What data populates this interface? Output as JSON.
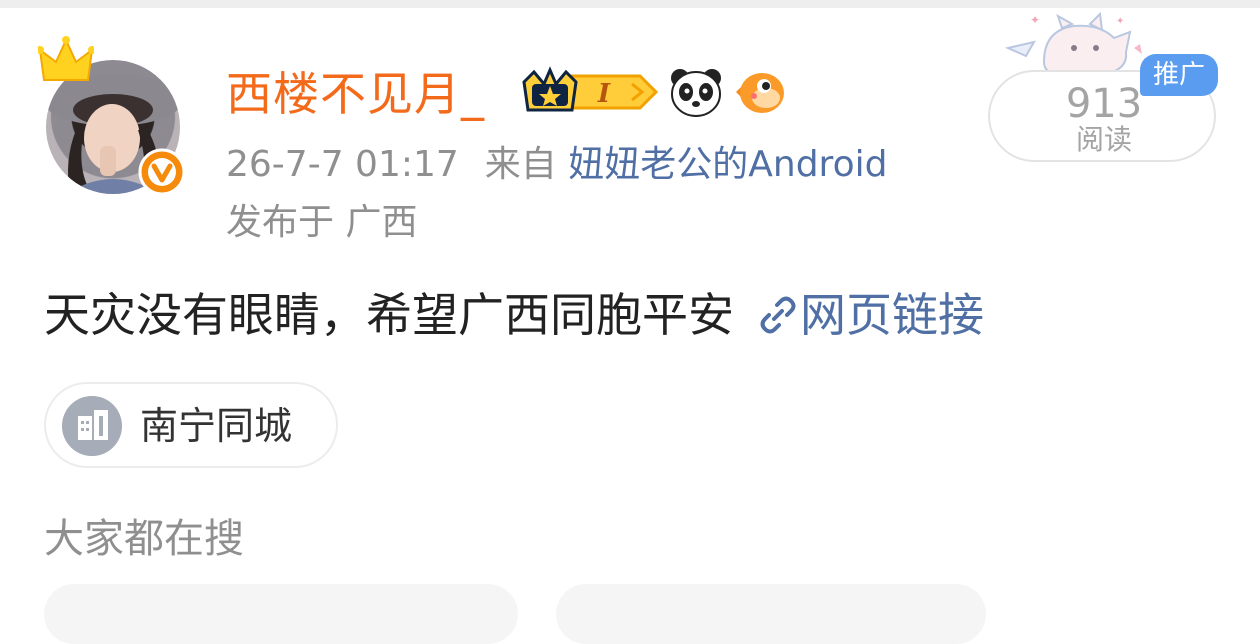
{
  "post": {
    "author": {
      "name": "西楼不见月_",
      "avatar_icon": "user-avatar",
      "crown_icon": "crown-icon",
      "verified_icon": "verified-v-icon",
      "badges": [
        "vip-level-badge",
        "panda-emoji-badge",
        "pufferfish-emoji-badge"
      ],
      "vip_level": "I"
    },
    "time": "26-7-7 01:17",
    "source_prefix": "来自",
    "source": "妞妞老公的Android",
    "location": "发布于 广西",
    "read_count": "913",
    "read_label": "阅读",
    "promo_label": "推广",
    "text": "天灾没有眼睛，希望广西同胞平安",
    "link_label": "网页链接",
    "link_icon": "link-icon",
    "topic": {
      "label": "南宁同城",
      "icon": "building-icon"
    }
  },
  "section": {
    "title": "大家都在搜"
  },
  "colors": {
    "username": "#f36a1b",
    "link": "#4f6fa5",
    "meta": "#8f8f8f",
    "promo": "#5a9cf0"
  }
}
